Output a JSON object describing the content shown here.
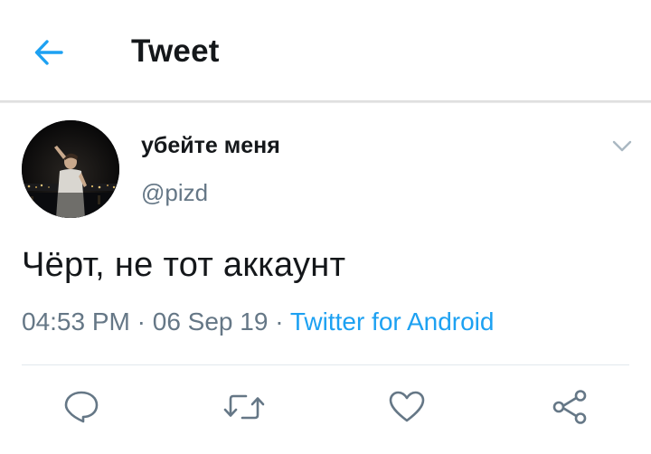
{
  "header": {
    "title": "Tweet",
    "back_icon": "arrow-left-icon",
    "accent_color": "#1da1f2"
  },
  "tweet": {
    "author": {
      "display_name": "убейте меня",
      "handle": "@pizd",
      "avatar": "avatar-photo"
    },
    "menu_icon": "chevron-down-icon",
    "text": "Чёрт, не тот аккаунт",
    "time": "04:53 PM",
    "separator": "·",
    "date": "06 Sep 19",
    "source": "Twitter for Android"
  },
  "actions": [
    {
      "name": "reply",
      "icon": "reply-icon"
    },
    {
      "name": "retweet",
      "icon": "retweet-icon"
    },
    {
      "name": "like",
      "icon": "heart-icon"
    },
    {
      "name": "share",
      "icon": "share-icon"
    }
  ],
  "colors": {
    "text_primary": "#14171a",
    "text_secondary": "#657786",
    "link": "#1da1f2",
    "icon": "#657786"
  }
}
